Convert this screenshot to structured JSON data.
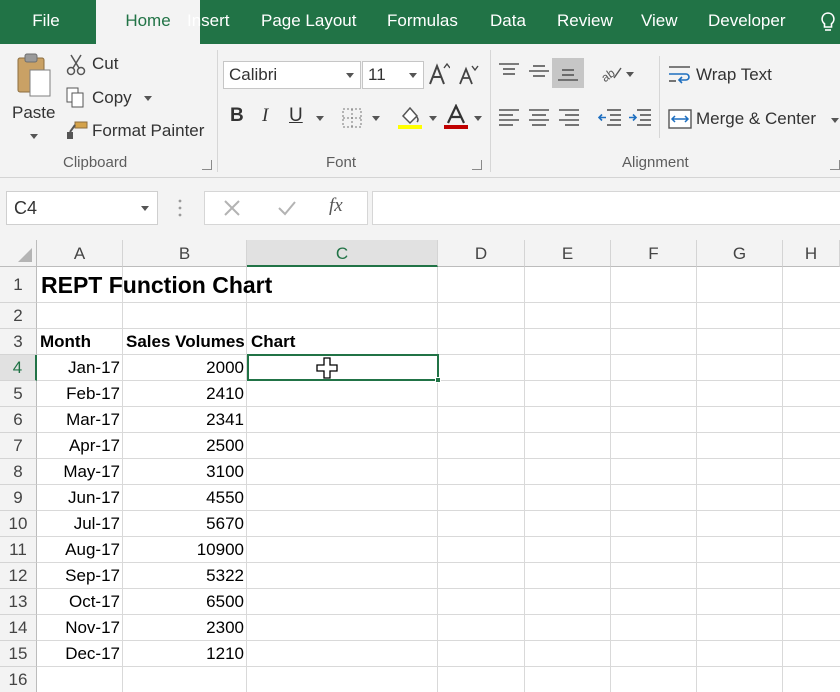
{
  "ribbon": {
    "tabs": [
      "File",
      "Home",
      "Insert",
      "Page Layout",
      "Formulas",
      "Data",
      "Review",
      "View",
      "Developer"
    ],
    "active_tab": "Home",
    "clipboard": {
      "paste_label": "Paste",
      "cut_label": "Cut",
      "copy_label": "Copy",
      "format_painter_label": "Format Painter",
      "group_label": "Clipboard"
    },
    "font": {
      "font_name": "Calibri",
      "font_size": "11",
      "bold_label": "B",
      "italic_label": "I",
      "underline_label": "U",
      "group_label": "Font",
      "highlight_color": "#ffff00",
      "font_color": "#c00000"
    },
    "alignment": {
      "wrap_text_label": "Wrap Text",
      "merge_center_label": "Merge & Center",
      "group_label": "Alignment"
    }
  },
  "formula_bar": {
    "name_box": "C4",
    "fx_label": "fx",
    "formula": ""
  },
  "sheet": {
    "columns": [
      "A",
      "B",
      "C",
      "D",
      "E",
      "F",
      "G",
      "H"
    ],
    "rows": [
      "1",
      "2",
      "3",
      "4",
      "5",
      "6",
      "7",
      "8",
      "9",
      "10",
      "11",
      "12",
      "13",
      "14",
      "15",
      "16"
    ],
    "selected_cell": "C4",
    "title": "REPT Function Chart",
    "headers": {
      "month": "Month",
      "sales": "Sales Volumes",
      "chart": "Chart"
    },
    "data": [
      {
        "month": "Jan-17",
        "sales": "2000"
      },
      {
        "month": "Feb-17",
        "sales": "2410"
      },
      {
        "month": "Mar-17",
        "sales": "2341"
      },
      {
        "month": "Apr-17",
        "sales": "2500"
      },
      {
        "month": "May-17",
        "sales": "3100"
      },
      {
        "month": "Jun-17",
        "sales": "4550"
      },
      {
        "month": "Jul-17",
        "sales": "5670"
      },
      {
        "month": "Aug-17",
        "sales": "10900"
      },
      {
        "month": "Sep-17",
        "sales": "5322"
      },
      {
        "month": "Oct-17",
        "sales": "6500"
      },
      {
        "month": "Nov-17",
        "sales": "2300"
      },
      {
        "month": "Dec-17",
        "sales": "1210"
      }
    ]
  },
  "colors": {
    "accent": "#217346",
    "ribbon_bg": "#f3f3f3"
  }
}
